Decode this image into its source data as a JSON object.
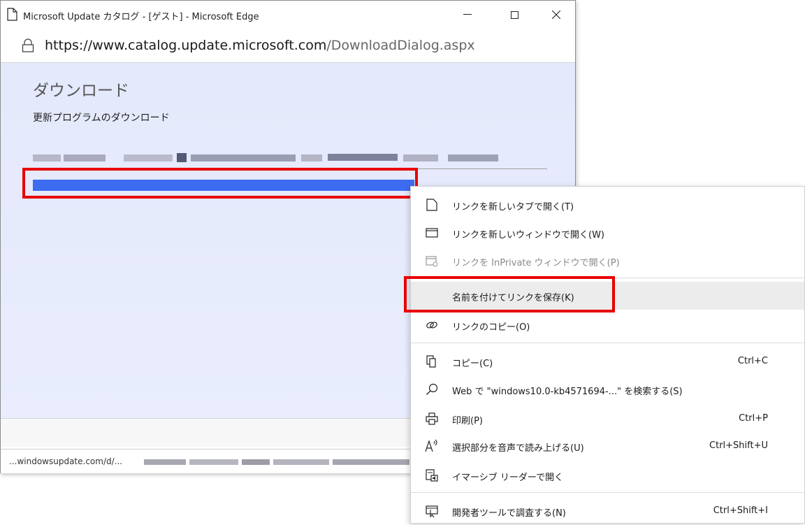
{
  "window": {
    "title": "Microsoft Update カタログ - [ゲスト] - Microsoft Edge",
    "url_host": "https://www.catalog.update.microsoft.com",
    "url_path": "/DownloadDialog.aspx"
  },
  "content": {
    "heading": "ダウンロード",
    "subheading": "更新プログラムのダウンロード"
  },
  "statusbar": {
    "text": "...windowsupdate.com/d/..."
  },
  "context_menu": {
    "items": [
      {
        "icon": "new-tab-icon",
        "label": "リンクを新しいタブで開く(T)",
        "shortcut": ""
      },
      {
        "icon": "new-window-icon",
        "label": "リンクを新しいウィンドウで開く(W)",
        "shortcut": ""
      },
      {
        "icon": "inprivate-icon",
        "label": "リンクを InPrivate ウィンドウで開く(P)",
        "shortcut": ""
      },
      {
        "icon": "",
        "label": "名前を付けてリンクを保存(K)",
        "shortcut": ""
      },
      {
        "icon": "link-icon",
        "label": "リンクのコピー(O)",
        "shortcut": ""
      },
      {
        "icon": "copy-icon",
        "label": "コピー(C)",
        "shortcut": "Ctrl+C"
      },
      {
        "icon": "search-icon",
        "label": "Web で \"windows10.0-kb4571694-...\" を検索する(S)",
        "shortcut": ""
      },
      {
        "icon": "print-icon",
        "label": "印刷(P)",
        "shortcut": "Ctrl+P"
      },
      {
        "icon": "read-aloud-icon",
        "label": "選択部分を音声で読み上げる(U)",
        "shortcut": "Ctrl+Shift+U"
      },
      {
        "icon": "immersive-reader-icon",
        "label": "イマーシブ リーダーで開く",
        "shortcut": ""
      },
      {
        "icon": "devtools-icon",
        "label": "開発者ツールで調査する(N)",
        "shortcut": "Ctrl+Shift+I"
      }
    ]
  },
  "colors": {
    "highlight_red": "#e80000",
    "link_selection": "#3d6cf0",
    "content_bg": "#e6ebfc",
    "menu_hover": "#ececec"
  }
}
